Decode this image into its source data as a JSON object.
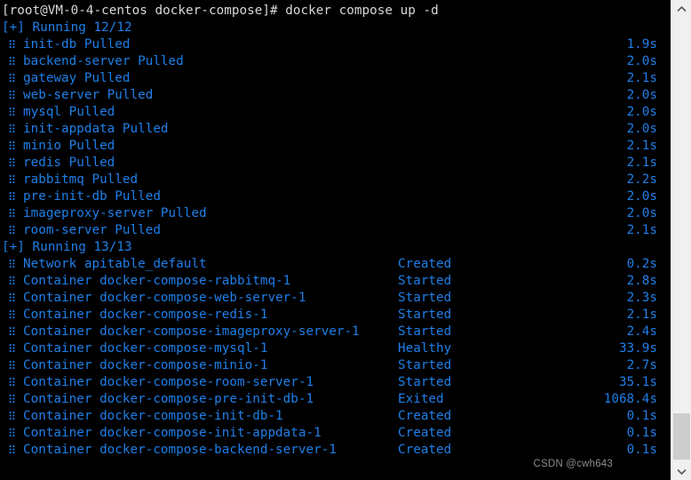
{
  "terminal": {
    "prompt_line": "[root@VM-0-4-centos docker-compose]# docker compose up -d",
    "pull_section": {
      "header": "[+] Running 12/12",
      "bullet": "⠿",
      "rows": [
        {
          "name": "init-db Pulled",
          "time": "1.9s"
        },
        {
          "name": "backend-server Pulled",
          "time": "2.0s"
        },
        {
          "name": "gateway Pulled",
          "time": "2.1s"
        },
        {
          "name": "web-server Pulled",
          "time": "2.0s"
        },
        {
          "name": "mysql Pulled",
          "time": "2.0s"
        },
        {
          "name": "init-appdata Pulled",
          "time": "2.0s"
        },
        {
          "name": "minio Pulled",
          "time": "2.1s"
        },
        {
          "name": "redis Pulled",
          "time": "2.1s"
        },
        {
          "name": "rabbitmq Pulled",
          "time": "2.2s"
        },
        {
          "name": "pre-init-db Pulled",
          "time": "2.0s"
        },
        {
          "name": "imageproxy-server Pulled",
          "time": "2.0s"
        },
        {
          "name": "room-server Pulled",
          "time": "2.1s"
        }
      ]
    },
    "run_section": {
      "header": "[+] Running 13/13",
      "bullet": "⠿",
      "rows": [
        {
          "name": "Network apitable_default",
          "status": "Created",
          "time": "0.2s"
        },
        {
          "name": "Container docker-compose-rabbitmq-1",
          "status": "Started",
          "time": "2.8s"
        },
        {
          "name": "Container docker-compose-web-server-1",
          "status": "Started",
          "time": "2.3s"
        },
        {
          "name": "Container docker-compose-redis-1",
          "status": "Started",
          "time": "2.1s"
        },
        {
          "name": "Container docker-compose-imageproxy-server-1",
          "status": "Started",
          "time": "2.4s"
        },
        {
          "name": "Container docker-compose-mysql-1",
          "status": "Healthy",
          "time": "33.9s"
        },
        {
          "name": "Container docker-compose-minio-1",
          "status": "Started",
          "time": "2.7s"
        },
        {
          "name": "Container docker-compose-room-server-1",
          "status": "Started",
          "time": "35.1s"
        },
        {
          "name": "Container docker-compose-pre-init-db-1",
          "status": "Exited",
          "time": "1068.4s"
        },
        {
          "name": "Container docker-compose-init-db-1",
          "status": "Created",
          "time": "0.1s"
        },
        {
          "name": "Container docker-compose-init-appdata-1",
          "status": "Created",
          "time": "0.1s"
        },
        {
          "name": "Container docker-compose-backend-server-1",
          "status": "Created",
          "time": "0.1s"
        }
      ]
    }
  },
  "scrollbar": {
    "up_arrow_icon": "chevron-up-icon",
    "down_arrow_icon": "chevron-down-icon"
  },
  "watermark": {
    "text": "CSDN @cwh643"
  },
  "colors": {
    "background": "#000000",
    "prompt_text": "#d8d8d8",
    "accent_blue": "#1f7fe8",
    "scrollbar_track": "#f0f0f0",
    "scrollbar_thumb": "#cdcdcd",
    "watermark_text": "#8d8d8d"
  }
}
